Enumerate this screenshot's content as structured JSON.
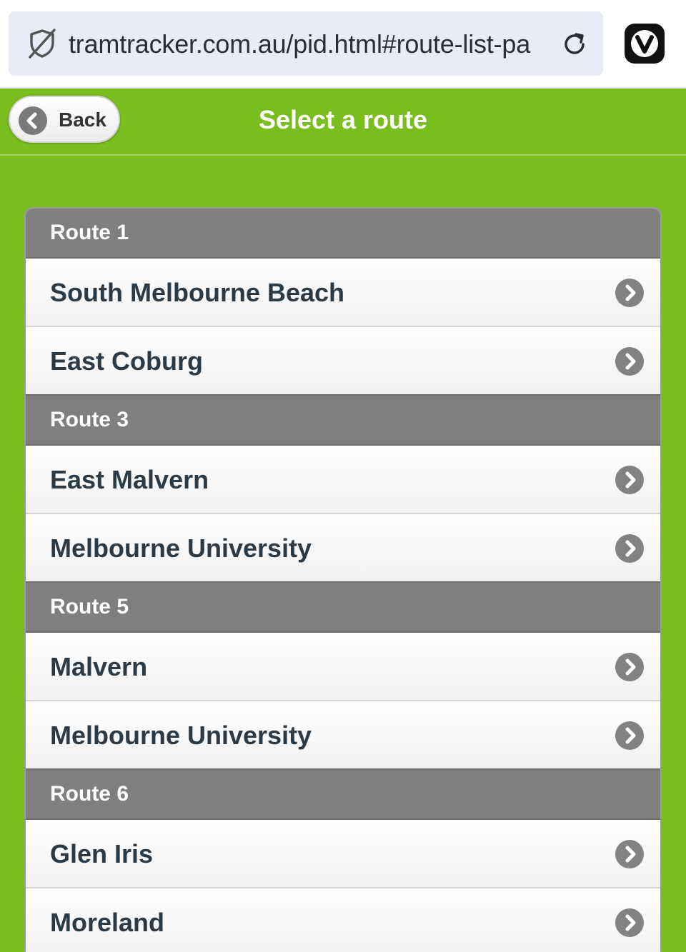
{
  "browser": {
    "url": "tramtracker.com.au/pid.html#route-list-pa",
    "icons": {
      "security": "shield-slash-icon",
      "reload": "reload-icon",
      "browser_logo": "vivaldi-logo-icon"
    }
  },
  "header": {
    "back_label": "Back",
    "title": "Select a route"
  },
  "routes": [
    {
      "label": "Route 1",
      "destinations": [
        "South Melbourne Beach",
        "East Coburg"
      ]
    },
    {
      "label": "Route 3",
      "destinations": [
        "East Malvern",
        "Melbourne University"
      ]
    },
    {
      "label": "Route 5",
      "destinations": [
        "Malvern",
        "Melbourne University"
      ]
    },
    {
      "label": "Route 6",
      "destinations": [
        "Glen Iris",
        "Moreland"
      ]
    }
  ],
  "colors": {
    "brand_green": "#7abd1f",
    "group_header_gray": "#7f7f7f",
    "item_text": "#2c3a45",
    "icon_gray": "#828282"
  }
}
